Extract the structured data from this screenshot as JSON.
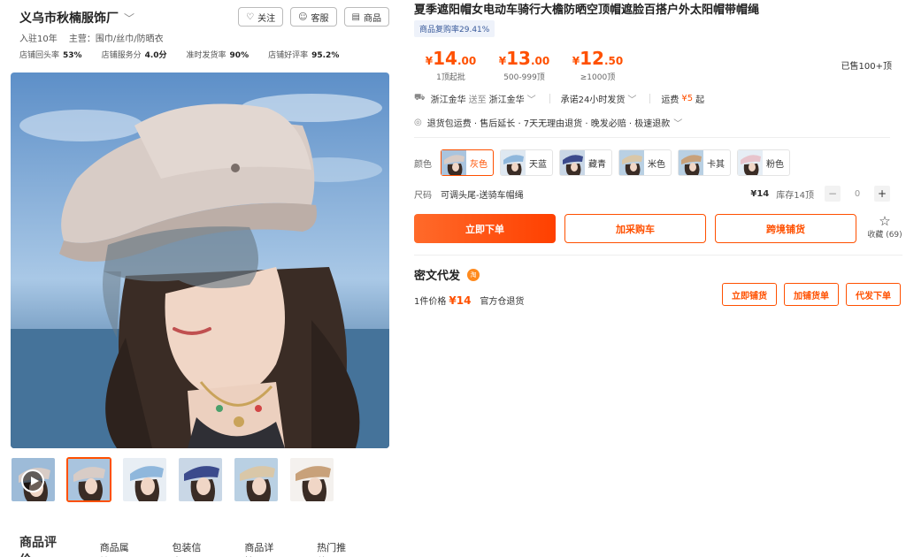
{
  "shop": {
    "name": "义乌市秋楠服饰厂",
    "buttons": [
      "关注",
      "客服",
      "商品"
    ],
    "years": "入驻10年",
    "main_products": "主营：围巾/丝巾/防晒衣",
    "stats": [
      {
        "label": "店铺回头率",
        "value": "53%"
      },
      {
        "label": "店铺服务分",
        "value": "4.0分"
      },
      {
        "label": "准时发货率",
        "value": "90%"
      },
      {
        "label": "店铺好评率",
        "value": "95.2%"
      }
    ]
  },
  "tabs": [
    "商品评价",
    "商品属性",
    "包装信息",
    "商品详情",
    "热门推荐"
  ],
  "product": {
    "title": "夏季遮阳帽女电动车骑行大檐防晒空顶帽遮脸百搭户外太阳帽带帽绳",
    "rebuy": "商品复购率29.41%",
    "prices": [
      {
        "currency": "¥",
        "int": "14",
        "dec": ".00",
        "qty": "1顶起批"
      },
      {
        "currency": "¥",
        "int": "13",
        "dec": ".00",
        "qty": "500-999顶"
      },
      {
        "currency": "¥",
        "int": "12",
        "dec": ".50",
        "qty": "≥1000顶"
      }
    ],
    "sold": "已售100+顶",
    "shipping": {
      "from": "浙江金华",
      "to_label": "送至",
      "to": "浙江金华",
      "promise": "承诺24小时发货",
      "fee_label": "运费",
      "fee": "¥5",
      "fee_suffix": "起"
    },
    "services": "退货包运费 · 售后延长 · 7天无理由退货 · 晚发必赔 · 极速退款",
    "color_label": "颜色",
    "colors": [
      "灰色",
      "天蓝",
      "藏青",
      "米色",
      "卡其",
      "粉色"
    ],
    "size_label": "尺码",
    "size": "可调头尾-送骑车帽绳",
    "size_price": "¥14",
    "stock": "库存14顶",
    "quantity": "0",
    "actions": [
      "立即下单",
      "加采购车",
      "跨境铺货"
    ],
    "favorite": "收藏 (69)"
  },
  "dropship": {
    "title": "密文代发",
    "badge": "淘",
    "price_label": "1件价格",
    "price": "¥14",
    "returns": "官方仓退货",
    "buttons": [
      "立即铺货",
      "加铺货单",
      "代发下单"
    ]
  },
  "colors": {
    "accent": "#ff5000",
    "hat_gray": "#d8ccc6",
    "hat_blue": "#8fb7dc",
    "hat_navy": "#3b4a8c",
    "hat_beige": "#d9c7a8",
    "hat_khaki": "#c8a17a",
    "hat_pink": "#e8c4cc"
  }
}
